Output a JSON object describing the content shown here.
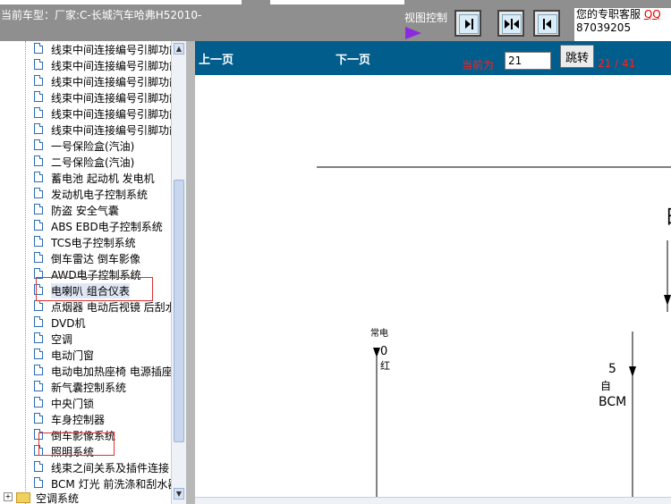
{
  "header": {
    "vehicle_label": "当前车型：厂家:C-长城汽车哈弗H52010-",
    "view_control_label": "视图控制",
    "service_line1": "您的专职客服",
    "service_qq": "QQ",
    "service_line2": "87039205"
  },
  "tree": {
    "items": [
      "线束中间连接编号引脚功能",
      "线束中间连接编号引脚功能",
      "线束中间连接编号引脚功能",
      "线束中间连接编号引脚功能",
      "线束中间连接编号引脚功能",
      "线束中间连接编号引脚功能",
      "一号保险盒(汽油)",
      "二号保险盒(汽油)",
      "蓄电池  起动机  发电机",
      "发动机电子控制系统",
      "防盗  安全气囊",
      "ABS EBD电子控制系统",
      "TCS电子控制系统",
      "倒车雷达  倒车影像",
      "AWD电子控制系统",
      "电喇叭  组合仪表",
      "点烟器  电动后视镜  后刮水器",
      "DVD机",
      "空调",
      "电动门窗",
      "电动电加热座椅  电源插座",
      "新气囊控制系统",
      "中央门锁",
      "车身控制器",
      "倒车影像系统",
      "照明系统",
      "线束之间关系及插件连接",
      "BCM 灯光  前洗涤和刮水器"
    ],
    "folder_label": "空调系统"
  },
  "nav": {
    "prev_label": "上一页",
    "next_label": "下一页",
    "current_label": "当前为",
    "page_value": "21",
    "go_label": "跳转",
    "page_count": "21 / 41"
  },
  "diagram": {
    "always_power_label": "常电",
    "wire_0": "0",
    "wire_red": "红",
    "pin_5": "5",
    "from_label": "自",
    "bcm_label": "BCM",
    "partial_char": "日"
  }
}
